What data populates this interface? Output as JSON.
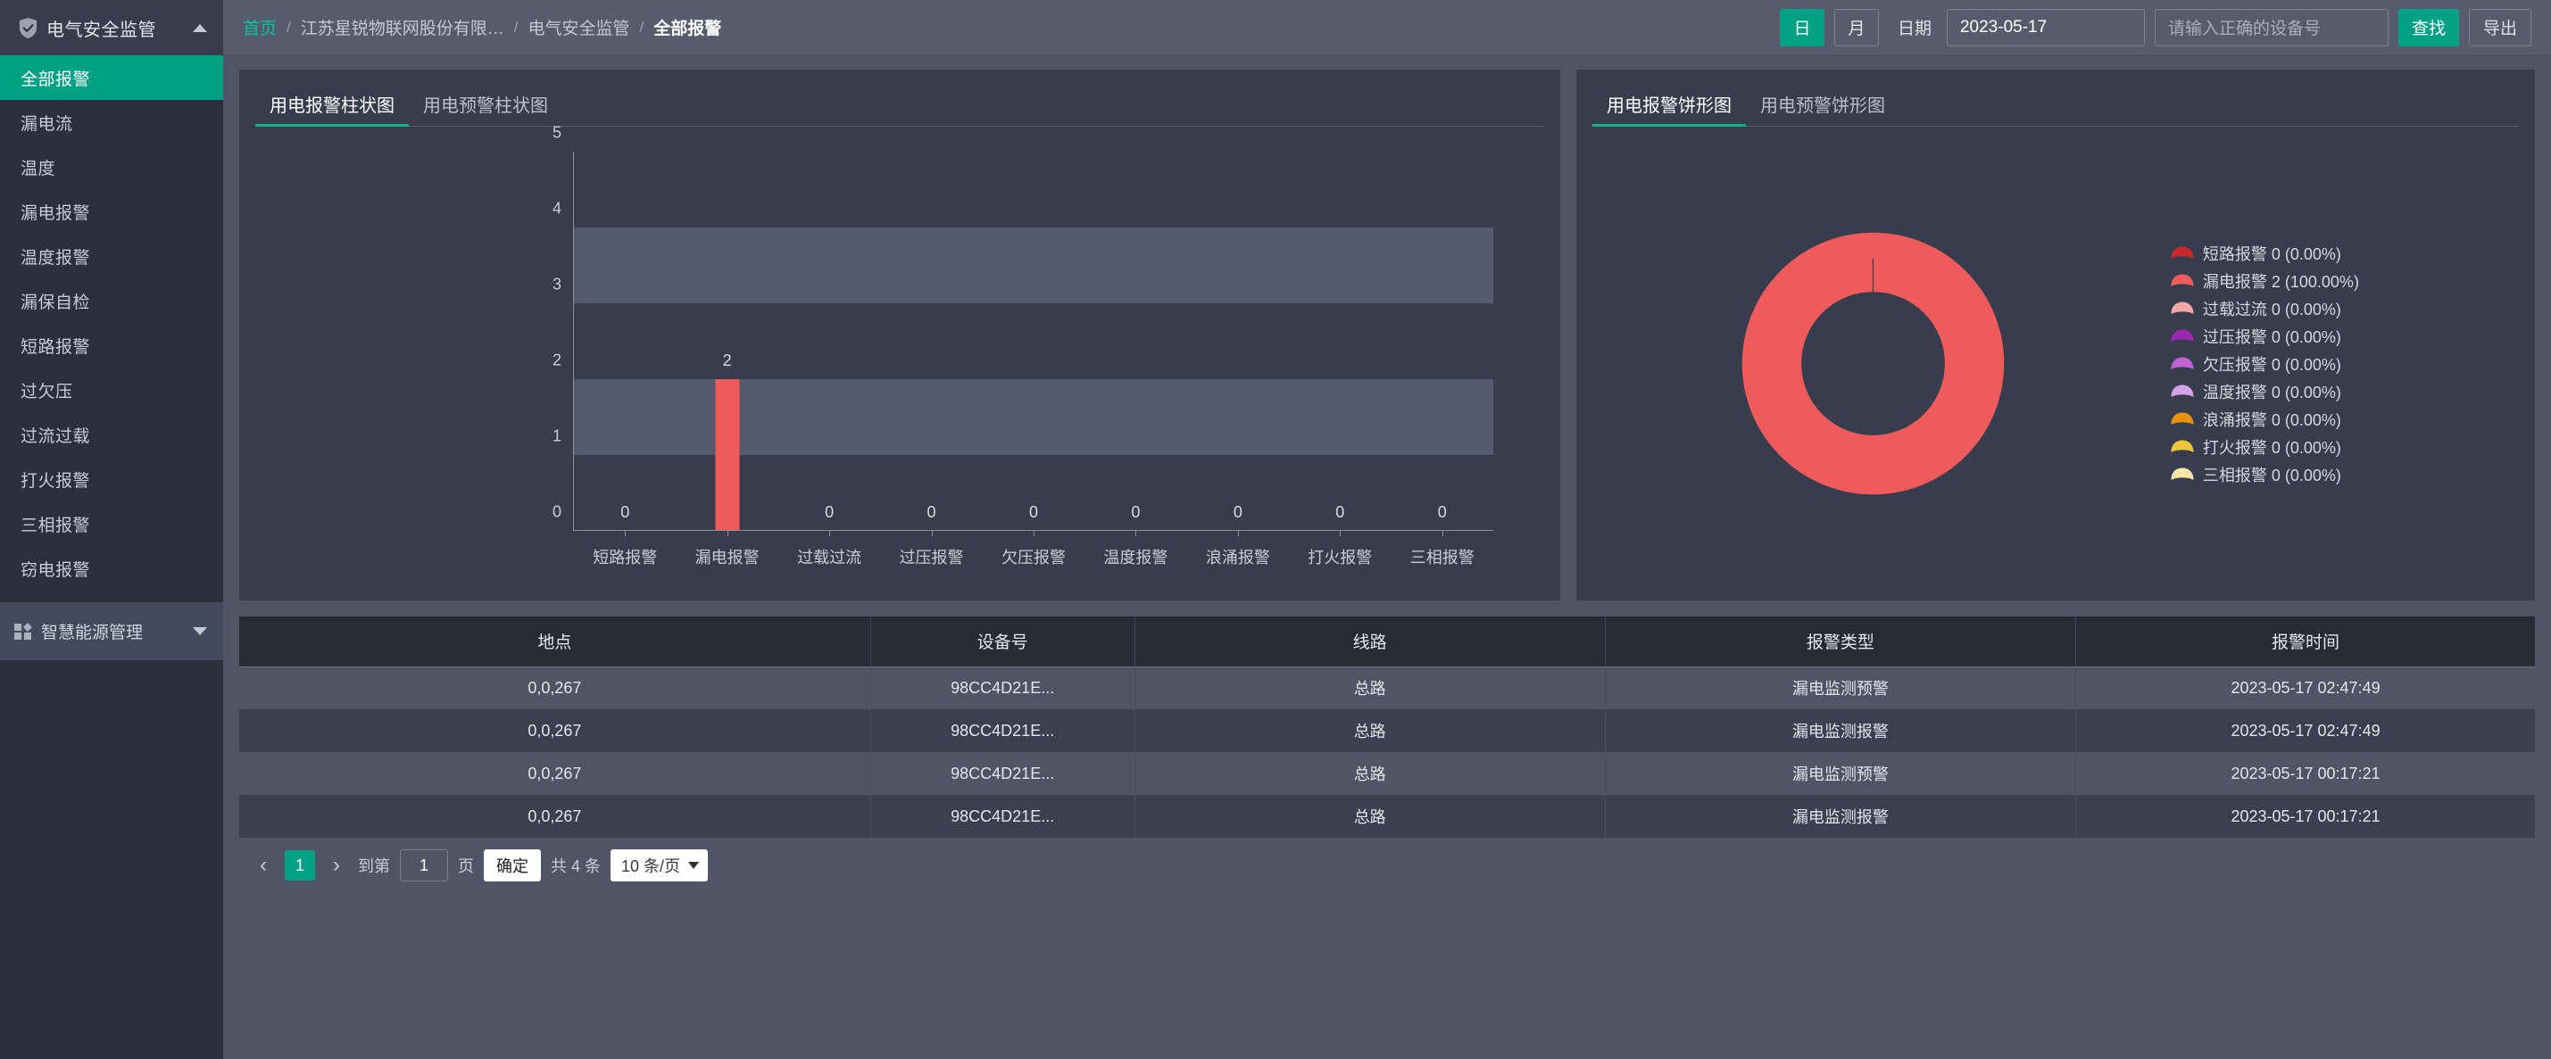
{
  "sidebar": {
    "app_title": "电气安全监管",
    "app_icon": "shield-check-icon",
    "collapse_icon": "chevron-up-icon",
    "items": [
      {
        "label": "全部报警",
        "active": true
      },
      {
        "label": "漏电流",
        "active": false
      },
      {
        "label": "温度",
        "active": false
      },
      {
        "label": "漏电报警",
        "active": false
      },
      {
        "label": "温度报警",
        "active": false
      },
      {
        "label": "漏保自检",
        "active": false
      },
      {
        "label": "短路报警",
        "active": false
      },
      {
        "label": "过欠压",
        "active": false
      },
      {
        "label": "过流过载",
        "active": false
      },
      {
        "label": "打火报警",
        "active": false
      },
      {
        "label": "三相报警",
        "active": false
      },
      {
        "label": "窃电报警",
        "active": false
      }
    ],
    "group": {
      "label": "智慧能源管理",
      "icon": "grid-apps-icon",
      "expand_icon": "chevron-down-icon"
    }
  },
  "topbar": {
    "breadcrumb": [
      {
        "label": "首页",
        "type": "home"
      },
      {
        "label": "江苏星锐物联网股份有限…",
        "type": "link"
      },
      {
        "label": "电气安全监管",
        "type": "link"
      },
      {
        "label": "全部报警",
        "type": "current"
      }
    ],
    "separator": "/",
    "day_button": "日",
    "month_button": "月",
    "date_label": "日期",
    "date_value": "2023-05-17",
    "device_placeholder": "请输入正确的设备号",
    "device_value": "",
    "search_button": "查找",
    "export_button": "导出",
    "accent_color": "#00a184"
  },
  "left_panel": {
    "tabs": [
      {
        "label": "用电报警柱状图",
        "active": true
      },
      {
        "label": "用电预警柱状图",
        "active": false
      }
    ]
  },
  "right_panel": {
    "tabs": [
      {
        "label": "用电报警饼形图",
        "active": true
      },
      {
        "label": "用电预警饼形图",
        "active": false
      }
    ]
  },
  "chart_data": [
    {
      "type": "bar",
      "title": "用电报警柱状图",
      "categories": [
        "短路报警",
        "漏电报警",
        "过载过流",
        "过压报警",
        "欠压报警",
        "温度报警",
        "浪涌报警",
        "打火报警",
        "三相报警"
      ],
      "values": [
        0,
        2,
        0,
        0,
        0,
        0,
        0,
        0,
        0
      ],
      "data_labels": [
        "0",
        "2",
        "0",
        "0",
        "0",
        "0",
        "0",
        "0",
        "0"
      ],
      "yticks": [
        0,
        1,
        2,
        3,
        4,
        5
      ],
      "ytick_labels": [
        "0",
        "1",
        "2",
        "3",
        "4",
        "5"
      ],
      "ylim": [
        0,
        5
      ],
      "xlabel": "",
      "ylabel": "",
      "grid": false,
      "bar_color": "#ef5b5b",
      "band_color": "#545b6d"
    },
    {
      "type": "pie",
      "title": "用电报警饼形图",
      "donut": true,
      "legend_position": "right",
      "labels": [
        "短路报警",
        "漏电报警",
        "过载过流",
        "过压报警",
        "欠压报警",
        "温度报警",
        "浪涌报警",
        "打火报警",
        "三相报警"
      ],
      "values": [
        0,
        2,
        0,
        0,
        0,
        0,
        0,
        0,
        0
      ],
      "percents": [
        "0.00%",
        "100.00%",
        "0.00%",
        "0.00%",
        "0.00%",
        "0.00%",
        "0.00%",
        "0.00%",
        "0.00%"
      ],
      "colors": [
        "#c6282b",
        "#ef5b5b",
        "#f3a7a6",
        "#9b27b0",
        "#c062d6",
        "#d3a3e8",
        "#e8930c",
        "#edc63c",
        "#fae5a8"
      ],
      "legend_entries": [
        "短路报警 0 (0.00%)",
        "漏电报警 2 (100.00%)",
        "过载过流 0 (0.00%)",
        "过压报警 0 (0.00%)",
        "欠压报警 0 (0.00%)",
        "温度报警 0 (0.00%)",
        "浪涌报警 0 (0.00%)",
        "打火报警 0 (0.00%)",
        "三相报警 0 (0.00%)"
      ]
    }
  ],
  "table": {
    "columns": [
      "地点",
      "设备号",
      "线路",
      "报警类型",
      "报警时间"
    ],
    "rows": [
      {
        "place": "0,0,267",
        "device": "98CC4D21E...",
        "line": "总路",
        "type": "漏电监测预警",
        "time": "2023-05-17 02:47:49"
      },
      {
        "place": "0,0,267",
        "device": "98CC4D21E...",
        "line": "总路",
        "type": "漏电监测报警",
        "time": "2023-05-17 02:47:49"
      },
      {
        "place": "0,0,267",
        "device": "98CC4D21E...",
        "line": "总路",
        "type": "漏电监测预警",
        "time": "2023-05-17 00:17:21"
      },
      {
        "place": "0,0,267",
        "device": "98CC4D21E...",
        "line": "总路",
        "type": "漏电监测报警",
        "time": "2023-05-17 00:17:21"
      }
    ]
  },
  "pagination": {
    "prev_icon": "chevron-left-icon",
    "next_icon": "chevron-right-icon",
    "current_page": "1",
    "goto_prefix": "到第",
    "goto_value": "1",
    "goto_suffix": "页",
    "confirm_label": "确定",
    "total_text": "共 4 条",
    "page_size": "10 条/页",
    "page_size_icon": "chevron-down-icon"
  }
}
